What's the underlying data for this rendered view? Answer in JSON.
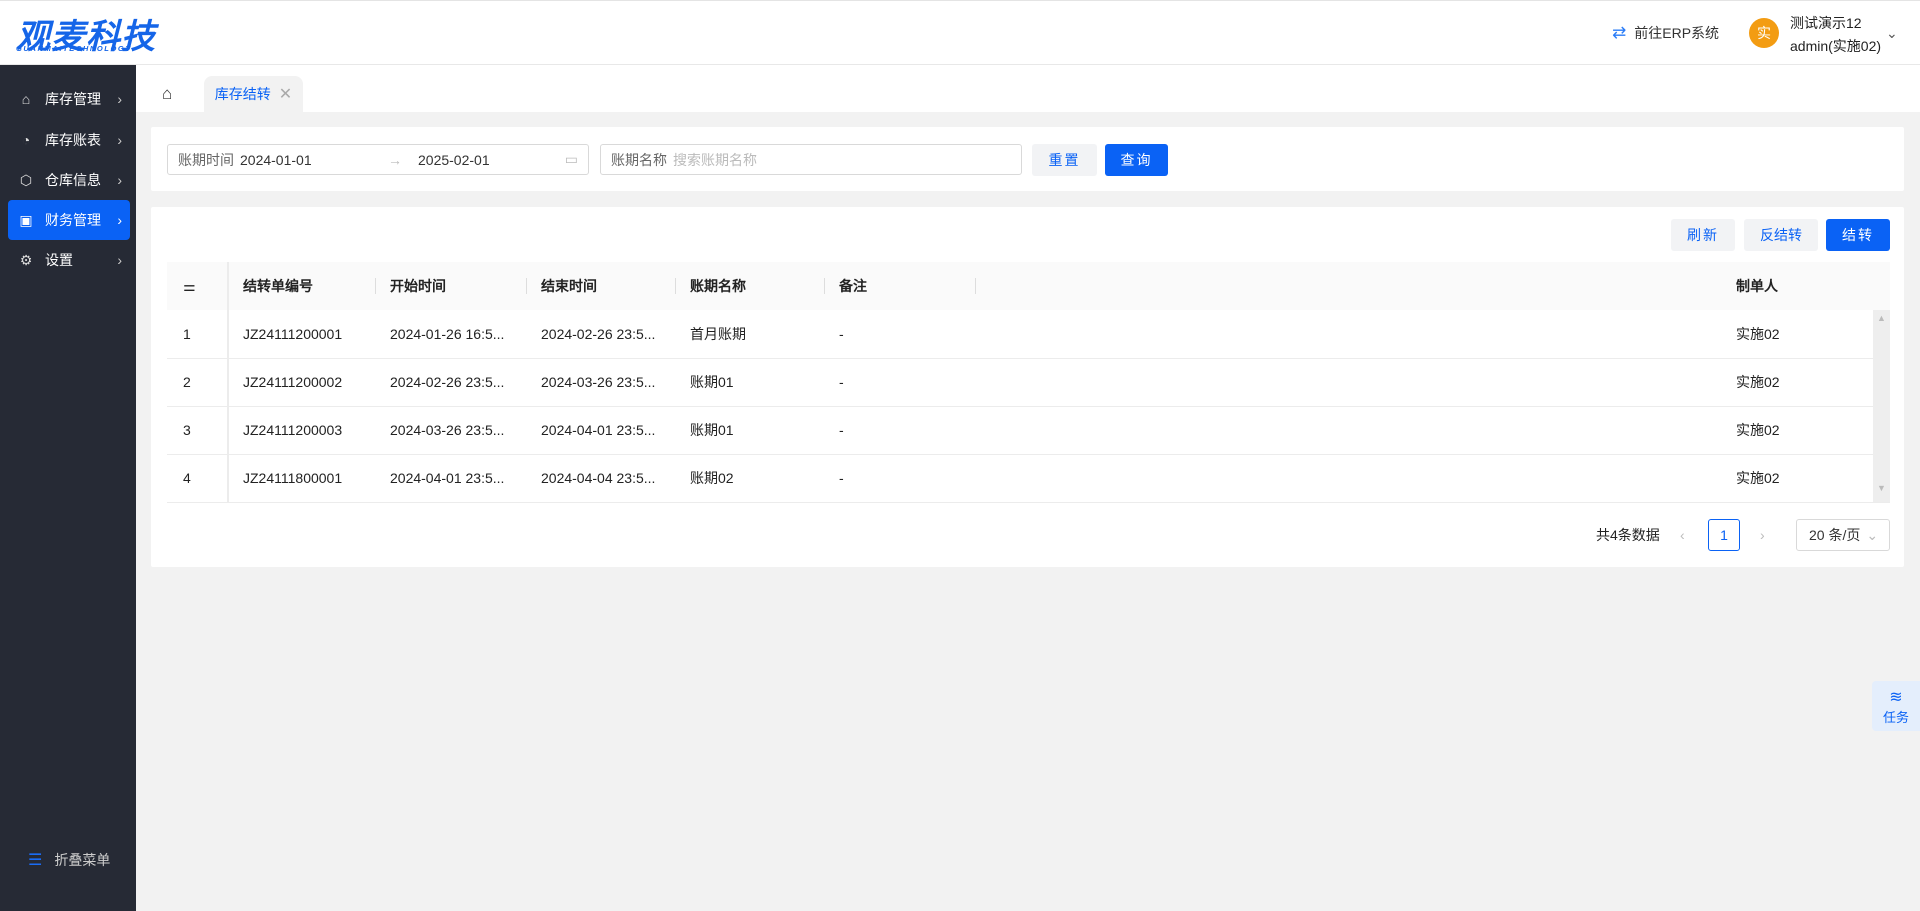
{
  "header": {
    "logo_cn": "观麦科技",
    "logo_en": "GUANMAITECHNOLOGY",
    "erp_link": "前往ERP系统",
    "avatar_char": "实",
    "user_name": "测试演示12",
    "user_account": "admin(实施02)"
  },
  "sidebar": {
    "items": [
      {
        "label": "库存管理",
        "icon": "warehouse-icon"
      },
      {
        "label": "库存账表",
        "icon": "pie-chart-icon"
      },
      {
        "label": "仓库信息",
        "icon": "cube-icon"
      },
      {
        "label": "财务管理",
        "icon": "finance-icon",
        "active": true
      },
      {
        "label": "设置",
        "icon": "gear-icon"
      }
    ],
    "collapse_label": "折叠菜单"
  },
  "tabs": [
    {
      "label": "库存结转",
      "active": true
    }
  ],
  "filter": {
    "period_label": "账期时间",
    "start_date": "2024-01-01",
    "end_date": "2025-02-01",
    "name_label": "账期名称",
    "name_placeholder": "搜索账期名称",
    "reset": "重置",
    "query": "查询"
  },
  "toolbar": {
    "refresh": "刷新",
    "reverse": "反结转",
    "carry": "结转"
  },
  "table": {
    "headers": [
      "结转单编号",
      "开始时间",
      "结束时间",
      "账期名称",
      "备注",
      "制单人"
    ],
    "rows": [
      [
        "1",
        "JZ24111200001",
        "2024-01-26 16:5...",
        "2024-02-26 23:5...",
        "首月账期",
        "-",
        "实施02"
      ],
      [
        "2",
        "JZ24111200002",
        "2024-02-26 23:5...",
        "2024-03-26 23:5...",
        "账期01",
        "-",
        "实施02"
      ],
      [
        "3",
        "JZ24111200003",
        "2024-03-26 23:5...",
        "2024-04-01 23:5...",
        "账期01",
        "-",
        "实施02"
      ],
      [
        "4",
        "JZ24111800001",
        "2024-04-01 23:5...",
        "2024-04-04 23:5...",
        "账期02",
        "-",
        "实施02"
      ]
    ]
  },
  "pagination": {
    "total": "共4条数据",
    "current": "1",
    "page_size": "20 条/页"
  },
  "task_widget": {
    "label": "任务"
  },
  "colors": {
    "primary": "#0a62f5",
    "sidebar": "#262a35",
    "avatar": "#f39c12"
  }
}
